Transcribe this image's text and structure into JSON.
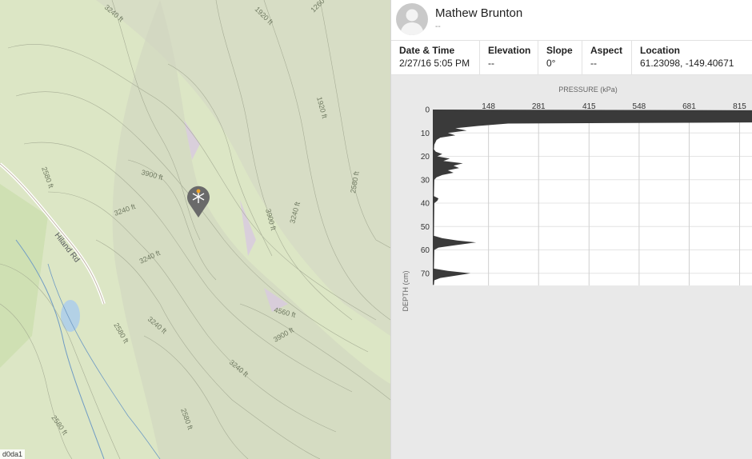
{
  "map": {
    "attribution": "d0da1",
    "road_label": "Hiland Rd",
    "contour_labels": [
      "3240 ft",
      "1920 ft",
      "1260 ft",
      "1920 ft",
      "2580 ft",
      "3900 ft",
      "2580 ft",
      "3240 ft",
      "3900 ft",
      "3240 ft",
      "3240 ft",
      "2580 ft",
      "4560 ft",
      "3240 ft",
      "3900 ft",
      "3240 ft",
      "2580 ft",
      "2580 ft"
    ],
    "marker_icon": "snowflake-marker-icon"
  },
  "profile": {
    "name": "Mathew Brunton",
    "subtitle": "--",
    "avatar_icon": "user-avatar-icon"
  },
  "info": [
    {
      "label": "Date & Time",
      "value": "2/27/16 5:05 PM"
    },
    {
      "label": "Elevation",
      "value": "--"
    },
    {
      "label": "Slope",
      "value": "0°"
    },
    {
      "label": "Aspect",
      "value": "--"
    },
    {
      "label": "Location",
      "value": "61.23098, -149.40671"
    }
  ],
  "chart_data": {
    "type": "area",
    "title": "PRESSURE (kPa)",
    "xlabel": "PRESSURE (kPa)",
    "ylabel": "DEPTH (cm)",
    "x_ticks": [
      148,
      281,
      415,
      548,
      681,
      815
    ],
    "y_ticks": [
      0,
      10,
      20,
      30,
      40,
      50,
      60,
      70
    ],
    "ylim": [
      0,
      75
    ],
    "xlim": [
      0,
      850
    ],
    "profile": [
      {
        "depth": 0,
        "pressure": 0
      },
      {
        "depth": 0.3,
        "pressure": 900
      },
      {
        "depth": 5.5,
        "pressure": 900
      },
      {
        "depth": 6.0,
        "pressure": 200
      },
      {
        "depth": 7.0,
        "pressure": 120
      },
      {
        "depth": 8.0,
        "pressure": 60
      },
      {
        "depth": 9.0,
        "pressure": 90
      },
      {
        "depth": 10.0,
        "pressure": 40
      },
      {
        "depth": 11.0,
        "pressure": 60
      },
      {
        "depth": 12.0,
        "pressure": 20
      },
      {
        "depth": 13.0,
        "pressure": 10
      },
      {
        "depth": 15.0,
        "pressure": 4
      },
      {
        "depth": 17.0,
        "pressure": 3
      },
      {
        "depth": 18.0,
        "pressure": 8
      },
      {
        "depth": 19.0,
        "pressure": 25
      },
      {
        "depth": 20.0,
        "pressure": 12
      },
      {
        "depth": 21.0,
        "pressure": 45
      },
      {
        "depth": 22.0,
        "pressure": 28
      },
      {
        "depth": 23.0,
        "pressure": 80
      },
      {
        "depth": 24.0,
        "pressure": 55
      },
      {
        "depth": 25.0,
        "pressure": 70
      },
      {
        "depth": 26.0,
        "pressure": 40
      },
      {
        "depth": 27.0,
        "pressure": 55
      },
      {
        "depth": 28.0,
        "pressure": 25
      },
      {
        "depth": 29.0,
        "pressure": 10
      },
      {
        "depth": 30.0,
        "pressure": 4
      },
      {
        "depth": 37.0,
        "pressure": 3
      },
      {
        "depth": 38.0,
        "pressure": 15
      },
      {
        "depth": 39.0,
        "pressure": 12
      },
      {
        "depth": 40.0,
        "pressure": 4
      },
      {
        "depth": 54.0,
        "pressure": 3
      },
      {
        "depth": 55.0,
        "pressure": 25
      },
      {
        "depth": 56.0,
        "pressure": 65
      },
      {
        "depth": 56.8,
        "pressure": 115
      },
      {
        "depth": 58.0,
        "pressure": 60
      },
      {
        "depth": 59.0,
        "pressure": 15
      },
      {
        "depth": 60.0,
        "pressure": 4
      },
      {
        "depth": 68.0,
        "pressure": 3
      },
      {
        "depth": 69.0,
        "pressure": 40
      },
      {
        "depth": 70.0,
        "pressure": 100
      },
      {
        "depth": 71.0,
        "pressure": 60
      },
      {
        "depth": 72.0,
        "pressure": 20
      },
      {
        "depth": 73.0,
        "pressure": 4
      },
      {
        "depth": 75.0,
        "pressure": 3
      }
    ],
    "grid": true
  }
}
